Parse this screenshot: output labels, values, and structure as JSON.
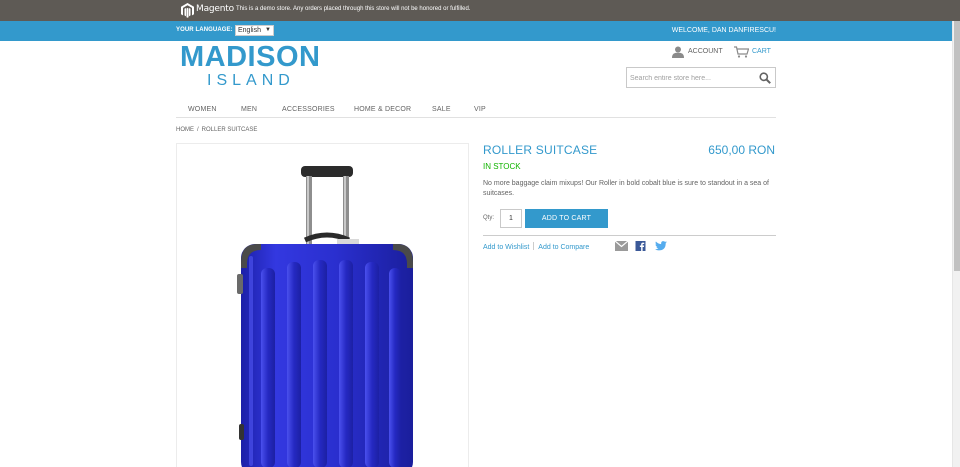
{
  "demo_bar": {
    "brand": "Magento",
    "notice": "This is a demo store. Any orders placed through this store will not be honored or fulfilled."
  },
  "lang_bar": {
    "label": "YOUR LANGUAGE:",
    "selected_language": "English",
    "welcome": "WELCOME, DAN DANFIRESCU!"
  },
  "header": {
    "logo_line1": "MADISON",
    "logo_line2": "ISLAND",
    "account_label": "ACCOUNT",
    "cart_label": "CART",
    "search_placeholder": "Search entire store here..."
  },
  "nav": {
    "items": [
      "WOMEN",
      "MEN",
      "ACCESSORIES",
      "HOME & DECOR",
      "SALE",
      "VIP"
    ]
  },
  "breadcrumb": {
    "home": "HOME",
    "separator": "/",
    "current": "ROLLER SUITCASE"
  },
  "product": {
    "name": "ROLLER SUITCASE",
    "price": "650,00 RON",
    "stock": "IN STOCK",
    "description": "No more baggage claim mixups! Our Roller in bold cobalt blue is sure to standout in a sea of suitcases.",
    "qty_label": "Qty:",
    "qty_value": "1",
    "add_to_cart_label": "ADD TO CART",
    "wishlist_label": "Add to Wishlist",
    "compare_label": "Add to Compare"
  },
  "colors": {
    "accent": "#3399cc",
    "demo_bar": "#5e5a55",
    "in_stock": "#11b400",
    "suitcase_blue": "#2a2fcf"
  },
  "icons": {
    "account": "person-icon",
    "cart": "cart-icon",
    "search": "search-icon",
    "email": "email-icon",
    "facebook": "facebook-icon",
    "twitter": "twitter-icon"
  }
}
